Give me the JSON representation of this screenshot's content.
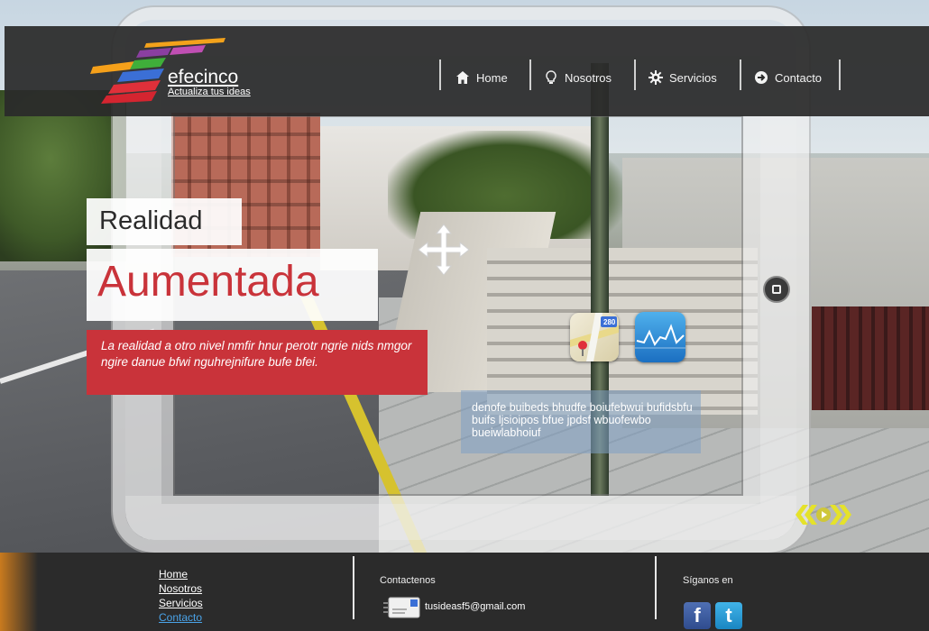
{
  "brand": {
    "name": "efecinco",
    "tagline": "Actualiza tus ideas"
  },
  "nav": [
    {
      "label": "Home",
      "icon": "home-icon"
    },
    {
      "label": "Nosotros",
      "icon": "lightbulb-icon"
    },
    {
      "label": "Servicios",
      "icon": "gear-icon"
    },
    {
      "label": "Contacto",
      "icon": "arrow-circle-icon"
    }
  ],
  "hero": {
    "line1": "Realidad",
    "line2": "Aumentada",
    "description": "La realidad a otro nivel nmfir hnur perotr ngrie nids nmgor ngire danue bfwi nguhrejnifure bufe bfei."
  },
  "info_box": {
    "text": "denofe buibeds bhudfe boiufebwui bufidsbfu buifs ljsioipos bfue jpdsf wbuofewbo bueiwlabhoiuf"
  },
  "apps": {
    "maps_badge": "280"
  },
  "footer": {
    "links": [
      "Home",
      "Nosotros",
      "Servicios",
      "Contacto"
    ],
    "contact_title": "Contactenos",
    "email": "tusideasf5@gmail.com",
    "follow_title": "Síganos en"
  },
  "colors": {
    "accent": "#c9333a",
    "header_bg": "#2a2a2a",
    "active_link": "#4aa3e8",
    "arrow_yellow": "#e5e22a"
  }
}
